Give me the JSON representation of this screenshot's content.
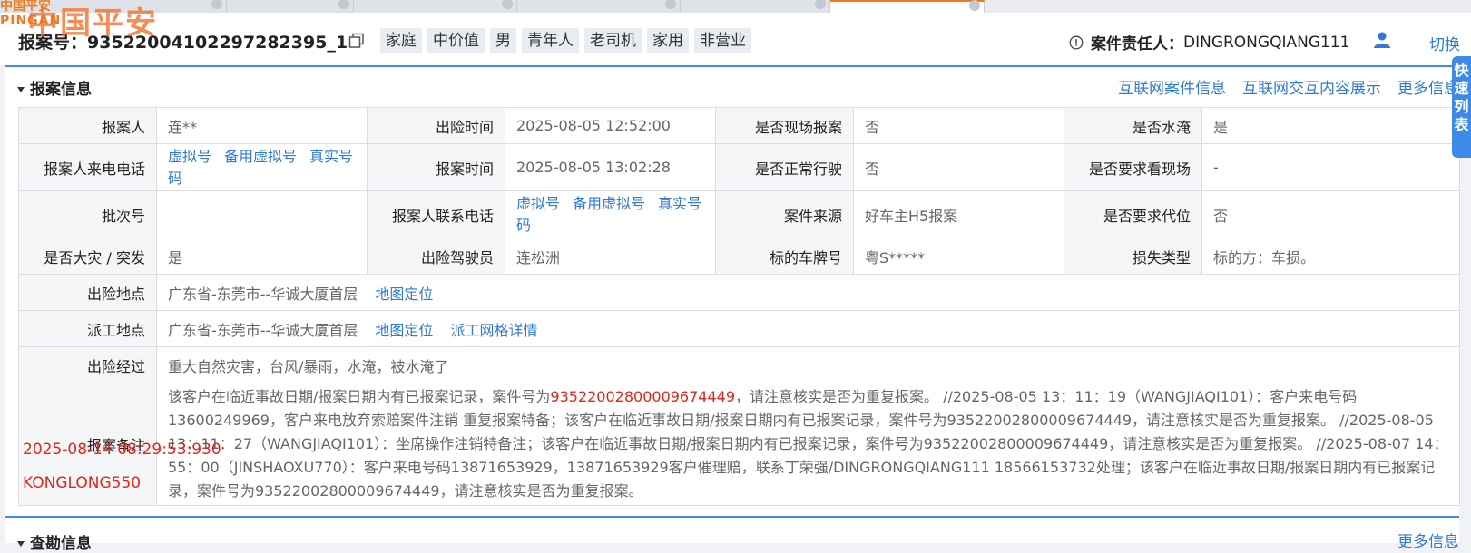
{
  "brand": {
    "small_cn": "中国平安",
    "en": "PINGAN",
    "big_cn": "中国平安",
    "color": "#f07b1f"
  },
  "header": {
    "case_label": "报案号：",
    "case_no": "93522004102297282395_1",
    "tags": [
      "家庭",
      "中价值",
      "男",
      "青年人",
      "老司机",
      "家用",
      "非营业"
    ],
    "owner_label": "案件责任人：",
    "owner_name": "DINGRONGQIANG111",
    "switch_label": "切换"
  },
  "section": {
    "title": "报案信息",
    "links": [
      "互联网案件信息",
      "互联网交互内容展示",
      "更多信息"
    ],
    "side_tab": "快速列表"
  },
  "rows": {
    "r1": {
      "reporter_label": "报案人",
      "reporter_value": "连**",
      "time_label": "出险时间",
      "time_value": "2025-08-05 12:52:00",
      "onsite_label": "是否现场报案",
      "onsite_value": "否",
      "flood_label": "是否水淹",
      "flood_value": "是"
    },
    "r2": {
      "phone_label": "报案人来电电话",
      "phone_links": [
        "虚拟号",
        "备用虚拟号",
        "真实号码"
      ],
      "report_time_label": "报案时间",
      "report_time_value": "2025-08-05 13:02:28",
      "normal_label": "是否正常行驶",
      "normal_value": "否",
      "visit_label": "是否要求看现场",
      "visit_value": "-"
    },
    "r3": {
      "batch_label": "批次号",
      "batch_value": "",
      "contact_label": "报案人联系电话",
      "contact_links": [
        "虚拟号",
        "备用虚拟号",
        "真实号码"
      ],
      "source_label": "案件来源",
      "source_value": "好车主H5报案",
      "proxy_label": "是否要求代位",
      "proxy_value": "否"
    },
    "r4": {
      "disaster_label": "是否大灾 / 突发",
      "disaster_value": "是",
      "driver_label": "出险驾驶员",
      "driver_value": "连松洲",
      "plate_label": "标的车牌号",
      "plate_value": "粤S*****",
      "loss_label": "损失类型",
      "loss_value": "标的方：车损。"
    },
    "r5": {
      "place_label": "出险地点",
      "place_value": "广东省-东莞市--华诚大厦首层",
      "map_link": "地图定位"
    },
    "r6": {
      "dispatch_label": "派工地点",
      "dispatch_value": "广东省-东莞市--华诚大厦首层",
      "map_link": "地图定位",
      "grid_link": "派工网格详情"
    },
    "r7": {
      "process_label": "出险经过",
      "process_value": "重大自然灾害，台风/暴雨，水淹，被水淹了"
    },
    "r8": {
      "remark_label": "报案备注",
      "remark_pre": "该客户在临近事故日期/报案日期内有已报案记录，案件号为",
      "remark_red": "93522002800009674449",
      "remark_post": "，请注意核实是否为重复报案。 //2025-08-05 13：11：19（WANGJIAQI101）：客户来电号码13600249969，客户来电放弃索赔案件注销 重复报案特备；该客户在临近事故日期/报案日期内有已报案记录，案件号为93522002800009674449，请注意核实是否为重复报案。 //2025-08-05 13：11：27（WANGJIAQI101）：坐席操作注销特备注；该客户在临近事故日期/报案日期内有已报案记录，案件号为93522002800009674449，请注意核实是否为重复报案。 //2025-08-07 14：55：00（JINSHAOXU770）：客户来电号码13871653929，13871653929客户催理赔，联系丁荣强/DINGRONGQIANG111 18566153732处理；该客户在临近事故日期/报案日期内有已报案记录，案件号为93522002800009674449，请注意核实是否为重复报案。"
    }
  },
  "watermark": {
    "time": "2025-08-14 08:29:53:930",
    "user": "KONGLONG550"
  },
  "bottom": {
    "title": "查勘信息",
    "more": "更多信息"
  },
  "colors": {
    "link": "#2f7ad6",
    "accent": "#3d8be6",
    "warning": "#e0261b",
    "brand": "#f07b1f"
  }
}
